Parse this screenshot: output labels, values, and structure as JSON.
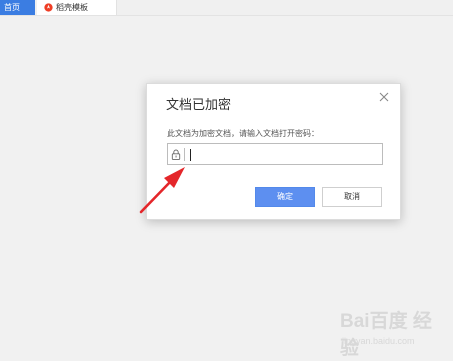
{
  "tabs": {
    "home_label": "首页",
    "template_label": "稻壳模板"
  },
  "dialog": {
    "title": "文档已加密",
    "prompt": "此文档为加密文档，请输入文档打开密码：",
    "password_value": "",
    "ok_label": "确定",
    "cancel_label": "取消"
  },
  "watermark": {
    "brand": "Bai百度 经验",
    "sub": "jingyan.baidu.com"
  },
  "colors": {
    "accent": "#3b7de2",
    "ok_button": "#5d8ff0",
    "arrow": "#e4262a"
  }
}
